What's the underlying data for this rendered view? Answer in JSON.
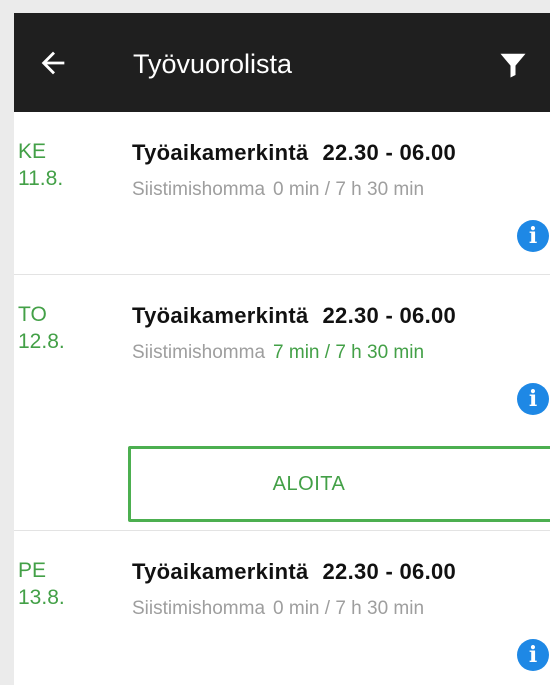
{
  "appbar": {
    "title": "Työvuorolista",
    "back_icon": "arrow-left-icon",
    "filter_icon": "filter-icon"
  },
  "colors": {
    "appbar_bg": "#1f1f1f",
    "accent_green": "#43a047",
    "info_blue": "#1e88e5",
    "muted_text": "#9e9e9e"
  },
  "shifts": [
    {
      "weekday": "KE",
      "date": "11.8.",
      "title": "Työaikamerkintä",
      "time": "22.30 - 06.00",
      "task": "Siistimishomma",
      "duration": "0 min / 7 h 30 min",
      "info_icon": "info-icon"
    },
    {
      "weekday": "TO",
      "date": "12.8.",
      "title": "Työaikamerkintä",
      "time": "22.30 - 06.00",
      "task": "Siistimishomma",
      "duration": "7 min / 7 h 30 min",
      "info_icon": "info-icon",
      "action_label": "ALOITA"
    },
    {
      "weekday": "PE",
      "date": "13.8.",
      "title": "Työaikamerkintä",
      "time": "22.30 - 06.00",
      "task": "Siistimishomma",
      "duration": "0 min / 7 h 30 min",
      "info_icon": "info-icon"
    }
  ]
}
